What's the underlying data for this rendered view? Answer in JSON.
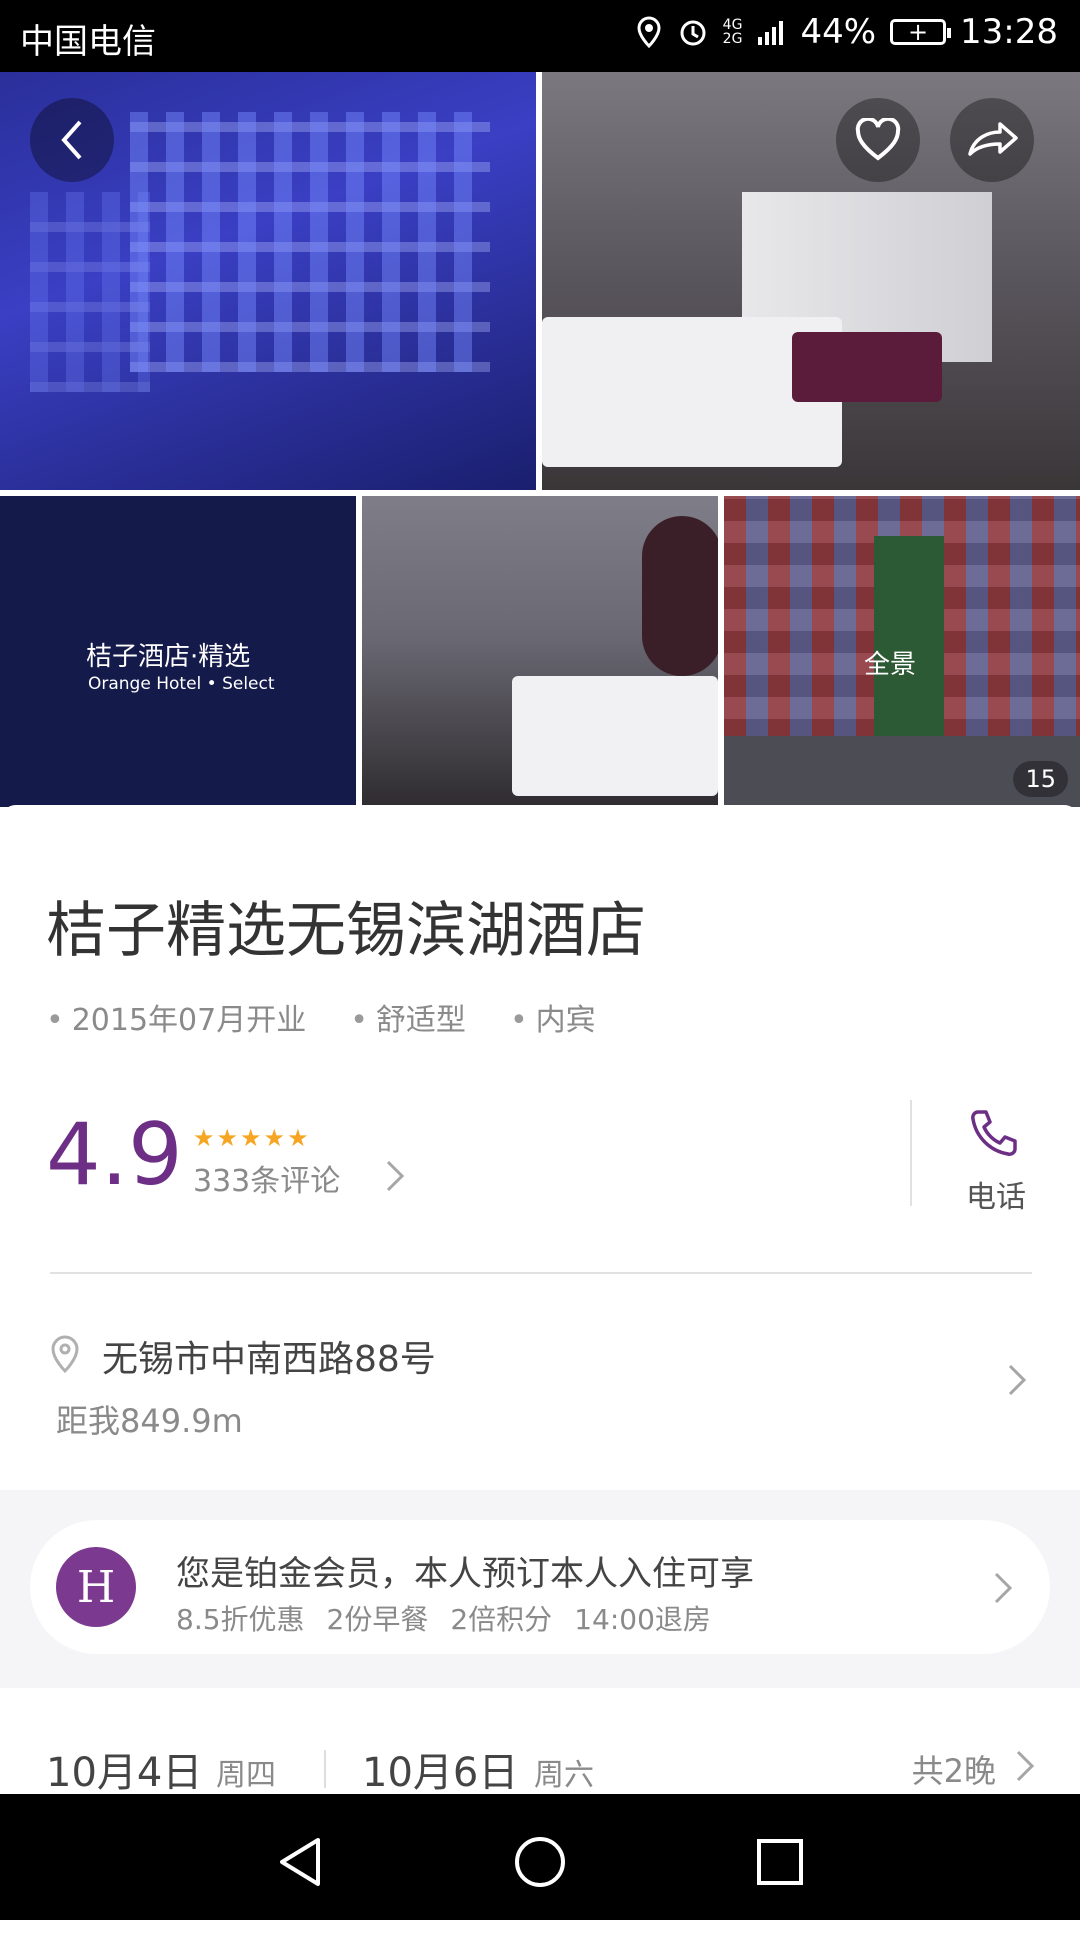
{
  "statusbar": {
    "carrier": "中国电信",
    "network_top": "4G",
    "network_bottom": "2G",
    "battery": "44%",
    "time": "13:28"
  },
  "gallery": {
    "logo_cn": "桔子酒店·精选",
    "logo_en": "Orange Hotel • Select",
    "pano_label": "全景",
    "count": "15"
  },
  "hotel": {
    "name": "桔子精选无锡滨湖酒店",
    "tags": [
      "2015年07月开业",
      "舒适型",
      "内宾"
    ],
    "rating": "4.9",
    "stars": 5,
    "reviews": "333条评论",
    "phone_label": "电话",
    "address": "无锡市中南西路88号",
    "distance": "距我849.9m"
  },
  "member": {
    "avatar_letter": "H",
    "line1": "您是铂金会员，本人预订本人入住可享",
    "benefits": [
      "8.5折优惠",
      "2份早餐",
      "2倍积分",
      "14:00退房"
    ]
  },
  "dates": {
    "checkin_date": "10月4日",
    "checkin_weekday": "周四",
    "checkout_date": "10月6日",
    "checkout_weekday": "周六",
    "nights": "共2晚"
  },
  "colors": {
    "accent_purple": "#6d2f86",
    "star": "#f6a623"
  },
  "icons": [
    "back-icon",
    "heart-icon",
    "share-icon",
    "phone-icon",
    "location-pin-icon",
    "chevron-right-icon",
    "nav-back-icon",
    "nav-home-icon",
    "nav-recent-icon"
  ]
}
